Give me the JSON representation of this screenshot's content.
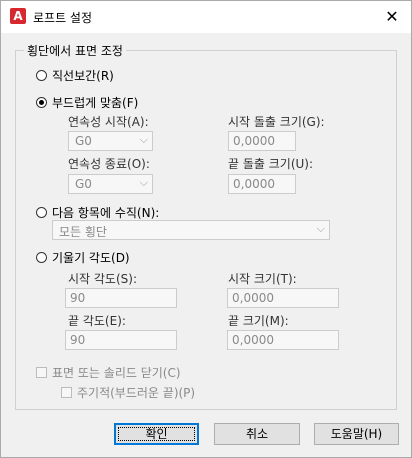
{
  "window": {
    "title": "로프트 설정",
    "app_icon_letter": "A"
  },
  "group": {
    "legend": "횡단에서 표면 조정"
  },
  "options": {
    "ruled": "직선보간(R)",
    "smooth_fit": "부드럽게 맞춤(F)",
    "normal_to": "다음 항목에 수직(N):",
    "draft_angles": "기울기 각도(D)",
    "selected": "smooth_fit"
  },
  "smooth": {
    "start_continuity_label": "연속성 시작(A):",
    "start_continuity_value": "G0",
    "start_bulge_label": "시작 돌출 크기(G):",
    "start_bulge_value": "0,0000",
    "end_continuity_label": "연속성 종료(O):",
    "end_continuity_value": "G0",
    "end_bulge_label": "끝 돌출 크기(U):",
    "end_bulge_value": "0,0000"
  },
  "normal": {
    "value": "모든 횡단"
  },
  "draft": {
    "start_angle_label": "시작 각도(S):",
    "start_angle_value": "90",
    "start_magnitude_label": "시작 크기(T):",
    "start_magnitude_value": "0,0000",
    "end_angle_label": "끝 각도(E):",
    "end_angle_value": "90",
    "end_magnitude_label": "끝 크기(M):",
    "end_magnitude_value": "0,0000"
  },
  "close_surface": {
    "label": "표면 또는 솔리드 닫기(C)",
    "periodic_label": "주기적(부드러운 끝)(P)"
  },
  "buttons": {
    "ok": "확인",
    "cancel": "취소",
    "help": "도움말(H)"
  }
}
